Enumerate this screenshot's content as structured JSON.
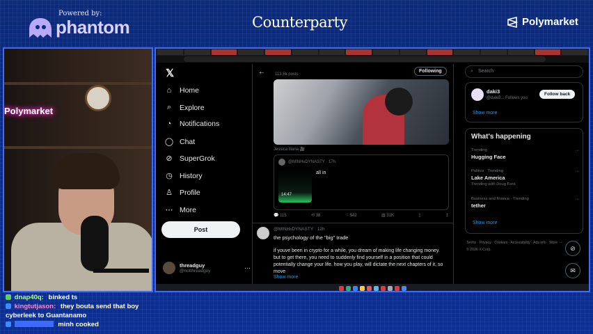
{
  "overlay": {
    "sponsor_prefix": "Powered by:",
    "sponsor_name": "phantom",
    "center_brand": "Counterparty",
    "right_brand": "Polymarket",
    "neon_sign": "Polymarket"
  },
  "x_sidebar": {
    "logo": "𝕏",
    "items": [
      {
        "label": "Home",
        "icon": "home-icon"
      },
      {
        "label": "Explore",
        "icon": "search-icon"
      },
      {
        "label": "Notifications",
        "icon": "bell-icon"
      },
      {
        "label": "Chat",
        "icon": "chat-icon"
      },
      {
        "label": "SuperGrok",
        "icon": "grok-icon"
      },
      {
        "label": "History",
        "icon": "history-icon"
      },
      {
        "label": "Profile",
        "icon": "profile-icon"
      },
      {
        "label": "More",
        "icon": "more-icon"
      }
    ],
    "post_button": "Post",
    "profile_name": "threadguy",
    "profile_handle": "@notthreadguy"
  },
  "main": {
    "posts_count": "113.5k posts",
    "following_button": "Following",
    "caption": "Jessica Iliana 🎥",
    "quote_handle": "@MINHxDYNASTY · 17h",
    "quote_text": "all in",
    "thumb_time": "14:47",
    "stats": [
      "115",
      "38",
      "542",
      "31K"
    ],
    "tweet2_handle": "@MINHxDYNASTY · 12h",
    "tweet2_title": "the psychology of the \"big\" trade",
    "tweet2_body": "if youve been in crypto for a while, you dream of making life changing money. but to get there, you need to suddenly find yourself in a position that could potentially change your life. how you play, will dictate the next chapters of it, so move",
    "show_more": "Show more"
  },
  "right": {
    "search_placeholder": "Search",
    "who_name": "daki3",
    "who_handle": "@daki3... Follows you",
    "follow_back": "Follow back",
    "show_more": "Show more",
    "happening_title": "What's happening",
    "trends": [
      {
        "category": "Trending",
        "name": "Hugging Face",
        "sub": ""
      },
      {
        "category": "Politics · Trending",
        "name": "Lake America",
        "sub": "Trending with Doug Ford"
      },
      {
        "category": "Business and finance · Trending",
        "name": "tether",
        "sub": ""
      }
    ],
    "trends_show_more": "Show more",
    "footer": "Terms · Privacy · Cookies · Accessibility · Ads info · More ··· © 2026 X Corp."
  },
  "chat": [
    {
      "user": "dnap40q:",
      "msg": "binked ts",
      "color": "#b7ff6e"
    },
    {
      "user": "kingtutjason:",
      "msg": "they bouta send that boy cyberleek to Guantanamo",
      "color": "#ff8bd6"
    },
    {
      "user": "",
      "msg": "minh cooked",
      "color": "#3b6cff"
    }
  ],
  "colors": {
    "x_blue": "#1d9bf0",
    "background_blue": "#0b2a86",
    "frame_border": "#3f6cff"
  }
}
